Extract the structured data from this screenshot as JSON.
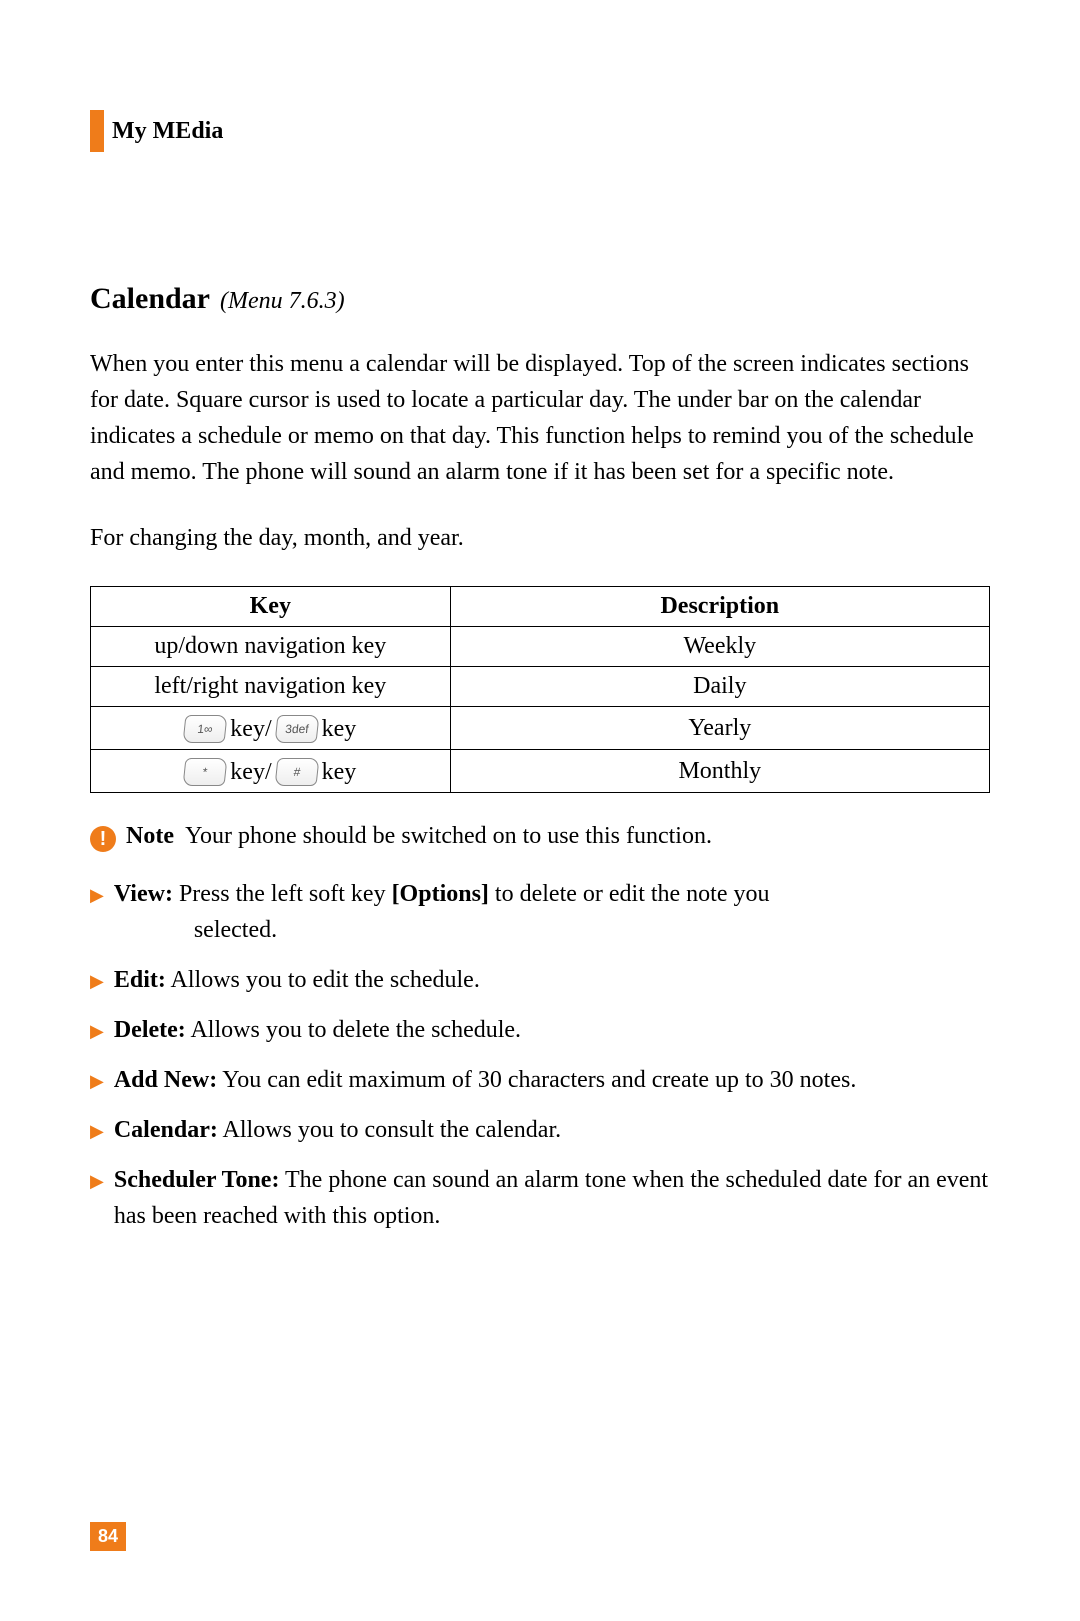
{
  "section_title": "My MEdia",
  "heading": {
    "title": "Calendar",
    "sub": "(Menu 7.6.3)"
  },
  "intro_paragraph": "When you enter this menu a calendar will be displayed. Top of the screen indicates sections for date. Square cursor is used to locate a particular day. The under bar on the calendar indicates a schedule or memo on that day. This function helps to remind you of the schedule and memo. The phone will sound an alarm tone if it has been set for a specific note.",
  "change_paragraph": "For changing the day, month, and year.",
  "table": {
    "headers": {
      "key": "Key",
      "desc": "Description"
    },
    "rows": [
      {
        "key_text": "up/down navigation key",
        "desc": "Weekly",
        "icons": []
      },
      {
        "key_text": "left/right navigation key",
        "desc": "Daily",
        "icons": []
      },
      {
        "key_prefix1": "1∞",
        "mid": " key/ ",
        "key_prefix2": "3def",
        "suffix": " key",
        "desc": "Yearly",
        "icons": [
          "1",
          "3"
        ]
      },
      {
        "key_prefix1": "*",
        "mid": " key/ ",
        "key_prefix2": "#",
        "suffix": " key",
        "desc": "Monthly",
        "icons": [
          "*",
          "#"
        ]
      }
    ]
  },
  "note": {
    "label": "Note",
    "text": "Your phone should be switched on to use this function."
  },
  "bullets": [
    {
      "label": "View:",
      "text_line1": " Press the left soft key ",
      "options": "[Options]",
      "text_line2": " to delete or edit the note you",
      "text_line3": "selected."
    },
    {
      "label": "Edit:",
      "text": " Allows you to edit the schedule."
    },
    {
      "label": "Delete:",
      "text": " Allows you to delete the schedule."
    },
    {
      "label": "Add New:",
      "text": " You can edit maximum of 30 characters and create up to 30 notes."
    },
    {
      "label": "Calendar:",
      "text": " Allows you to consult the calendar."
    },
    {
      "label": "Scheduler Tone:",
      "text": " The phone can sound an alarm tone when the scheduled date for an event has been reached with this option."
    }
  ],
  "key_word": "key",
  "slash": " key/ ",
  "page_number": "84"
}
